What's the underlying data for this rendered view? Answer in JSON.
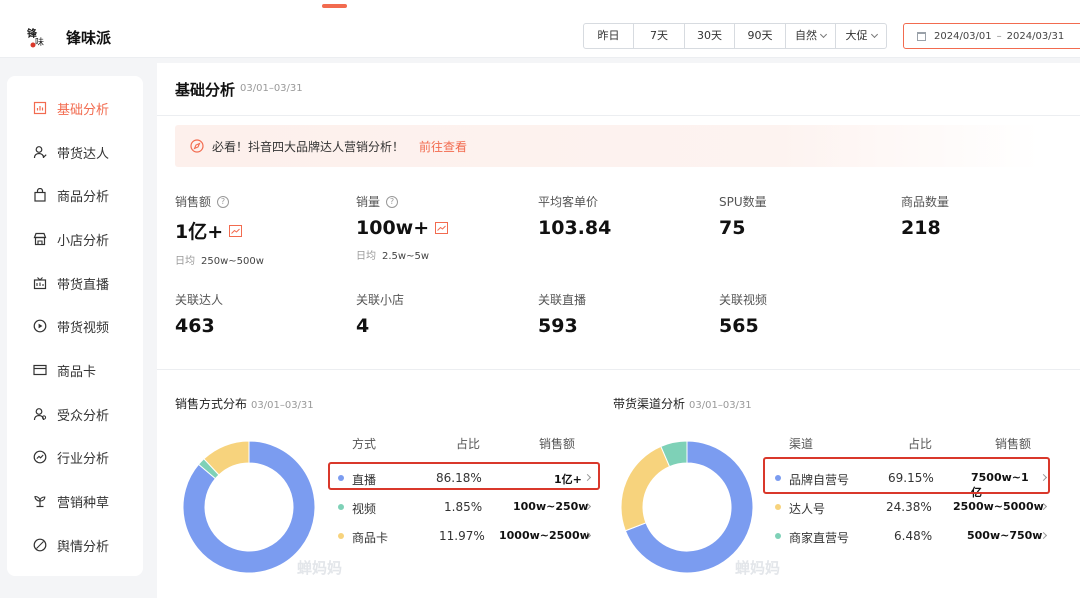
{
  "header": {
    "logo_text": "锋味",
    "app_title": "锋味派",
    "ranges": [
      "昨日",
      "7天",
      "30天",
      "90天"
    ],
    "dropdowns": [
      "自然",
      "大促"
    ],
    "date_start": "2024/03/01",
    "date_sep": "–",
    "date_end": "2024/03/31"
  },
  "sidebar": {
    "items": [
      {
        "label": "基础分析",
        "icon": "chart-icon",
        "active": true
      },
      {
        "label": "带货达人",
        "icon": "user-icon"
      },
      {
        "label": "商品分析",
        "icon": "bag-icon"
      },
      {
        "label": "小店分析",
        "icon": "store-icon"
      },
      {
        "label": "带货直播",
        "icon": "live-icon"
      },
      {
        "label": "带货视频",
        "icon": "play-icon"
      },
      {
        "label": "商品卡",
        "icon": "card-icon"
      },
      {
        "label": "受众分析",
        "icon": "audience-icon"
      },
      {
        "label": "行业分析",
        "icon": "trend-icon"
      },
      {
        "label": "营销种草",
        "icon": "sprout-icon"
      },
      {
        "label": "舆情分析",
        "icon": "sentiment-icon"
      }
    ]
  },
  "page": {
    "title": "基础分析",
    "date": "03/01–03/31"
  },
  "notice": {
    "text": "必看！抖音四大品牌达人营销分析！",
    "link": "前往查看"
  },
  "metrics": [
    {
      "label": "销售额",
      "value": "1亿+",
      "help": true,
      "trend": true,
      "sub_label": "日均",
      "sub_value": "250w~500w"
    },
    {
      "label": "销量",
      "value": "100w+",
      "help": true,
      "trend": true,
      "sub_label": "日均",
      "sub_value": "2.5w~5w"
    },
    {
      "label": "平均客单价",
      "value": "103.84"
    },
    {
      "label": "SPU数量",
      "value": "75"
    },
    {
      "label": "商品数量",
      "value": "218"
    },
    {
      "label": "关联达人",
      "value": "463"
    },
    {
      "label": "关联小店",
      "value": "4"
    },
    {
      "label": "关联直播",
      "value": "593"
    },
    {
      "label": "关联视频",
      "value": "565"
    }
  ],
  "sales_method": {
    "title": "销售方式分布",
    "date": "03/01–03/31",
    "headers": [
      "方式",
      "占比",
      "销售额"
    ],
    "rows": [
      {
        "name": "直播",
        "pct": "86.18%",
        "amount": "1亿+",
        "color": "#7b9cf0"
      },
      {
        "name": "视频",
        "pct": "1.85%",
        "amount": "100w~250w",
        "color": "#7ed1b7"
      },
      {
        "name": "商品卡",
        "pct": "11.97%",
        "amount": "1000w~2500w",
        "color": "#f7d37d"
      }
    ]
  },
  "channel": {
    "title": "带货渠道分析",
    "date": "03/01–03/31",
    "headers": [
      "渠道",
      "占比",
      "销售额"
    ],
    "rows": [
      {
        "name": "品牌自营号",
        "pct": "69.15%",
        "amount": "7500w~1亿",
        "color": "#7b9cf0"
      },
      {
        "name": "达人号",
        "pct": "24.38%",
        "amount": "2500w~5000w",
        "color": "#f7d37d"
      },
      {
        "name": "商家直营号",
        "pct": "6.48%",
        "amount": "500w~750w",
        "color": "#7ed1b7"
      }
    ]
  },
  "chart_data": [
    {
      "type": "pie",
      "title": "销售方式分布",
      "categories": [
        "直播",
        "视频",
        "商品卡"
      ],
      "values": [
        86.18,
        1.85,
        11.97
      ]
    },
    {
      "type": "pie",
      "title": "带货渠道分析",
      "categories": [
        "品牌自营号",
        "达人号",
        "商家直营号"
      ],
      "values": [
        69.15,
        24.38,
        6.48
      ]
    }
  ],
  "watermark": "蝉妈妈"
}
